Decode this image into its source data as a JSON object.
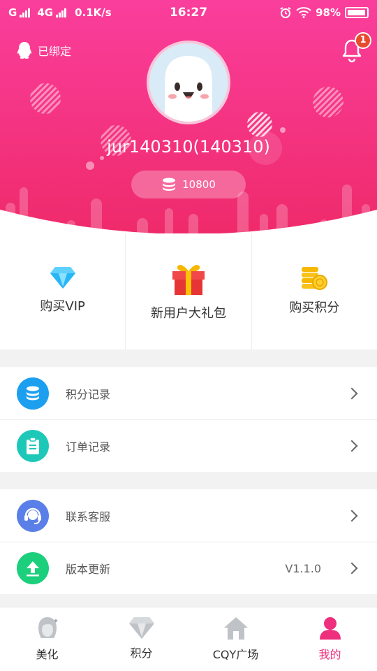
{
  "status_bar": {
    "carrier1": "G",
    "carrier2": "4G",
    "speed": "0.1K/s",
    "time": "16:27",
    "battery": "98%",
    "icons": [
      "signal-icon",
      "alarm-icon",
      "wifi-icon",
      "battery-icon"
    ]
  },
  "header": {
    "bound_label": "已绑定",
    "bound_icon": "qq-icon",
    "notification_count": "1",
    "username": "jur140310(140310)",
    "points": "10800",
    "colors": {
      "top": "#f9409a",
      "bottom": "#ee2a6e"
    }
  },
  "quick_actions": [
    {
      "label": "购买VIP",
      "icon": "diamond-icon"
    },
    {
      "label": "新用户大礼包",
      "icon": "gift-icon"
    },
    {
      "label": "购买积分",
      "icon": "coins-icon"
    }
  ],
  "menu": {
    "group1": [
      {
        "label": "积分记录",
        "icon": "database-icon",
        "color": "#1d9ff0"
      },
      {
        "label": "订单记录",
        "icon": "clipboard-icon",
        "color": "#1ec8b8"
      }
    ],
    "group2": [
      {
        "label": "联系客服",
        "icon": "headset-icon",
        "color": "#5a7fe8"
      },
      {
        "label": "版本更新",
        "icon": "upload-icon",
        "color": "#1ccf7c",
        "value": "V1.1.0"
      }
    ]
  },
  "bottom_nav": [
    {
      "label": "美化",
      "icon": "beauty-icon",
      "active": false
    },
    {
      "label": "积分",
      "icon": "diamond-icon",
      "active": false
    },
    {
      "label": "CQY广场",
      "icon": "home-icon",
      "active": false
    },
    {
      "label": "我的",
      "icon": "user-icon",
      "active": true
    }
  ],
  "accent_color": "#ee2f7d"
}
